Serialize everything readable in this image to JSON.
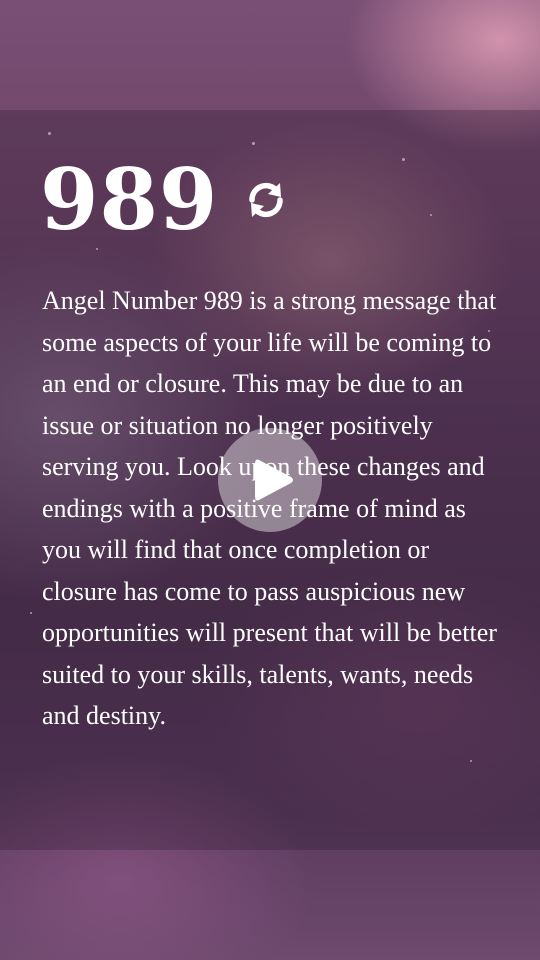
{
  "card": {
    "title": "989",
    "description": "Angel Number 989 is a strong message that some aspects of your life will be coming to an end or closure. This may be due to an issue or situation no longer positively serving you. Look upon these changes and endings with a positive frame of mind as you will find that once completion or closure has come to pass auspicious new opportunities will present that will be better suited to your skills, talents, wants, needs and destiny."
  },
  "icons": {
    "refresh": "refresh-icon",
    "play": "play-icon"
  },
  "colors": {
    "text": "#ffffff",
    "play_button_bg": "rgba(255,255,255,0.42)"
  }
}
